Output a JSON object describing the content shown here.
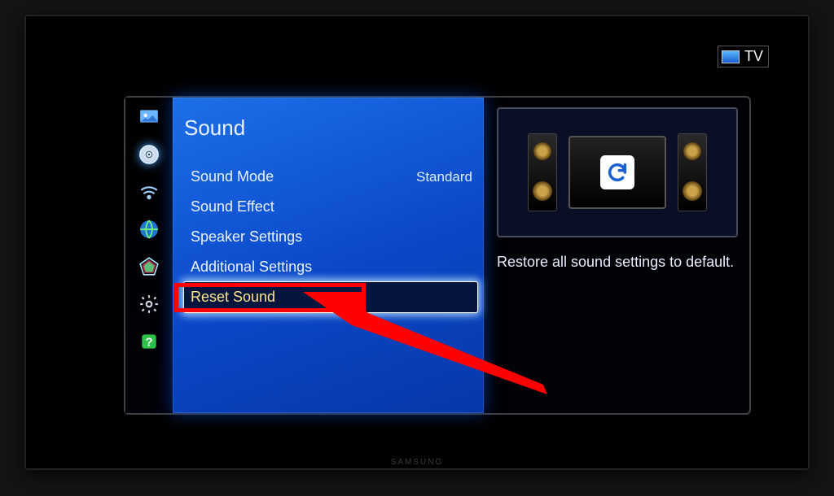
{
  "source_label": "TV",
  "brand": "SAMSUNG",
  "menu": {
    "title": "Sound",
    "items": [
      {
        "label": "Sound Mode",
        "value": "Standard",
        "selected": false
      },
      {
        "label": "Sound Effect",
        "value": "",
        "selected": false
      },
      {
        "label": "Speaker Settings",
        "value": "",
        "selected": false
      },
      {
        "label": "Additional Settings",
        "value": "",
        "selected": false
      },
      {
        "label": "Reset Sound",
        "value": "",
        "selected": true
      }
    ]
  },
  "info": {
    "description": "Restore all sound settings to default."
  },
  "sidebar_icons": [
    "picture-icon",
    "sound-icon",
    "network-icon",
    "broadcast-icon",
    "smarthub-icon",
    "system-icon",
    "support-icon"
  ]
}
